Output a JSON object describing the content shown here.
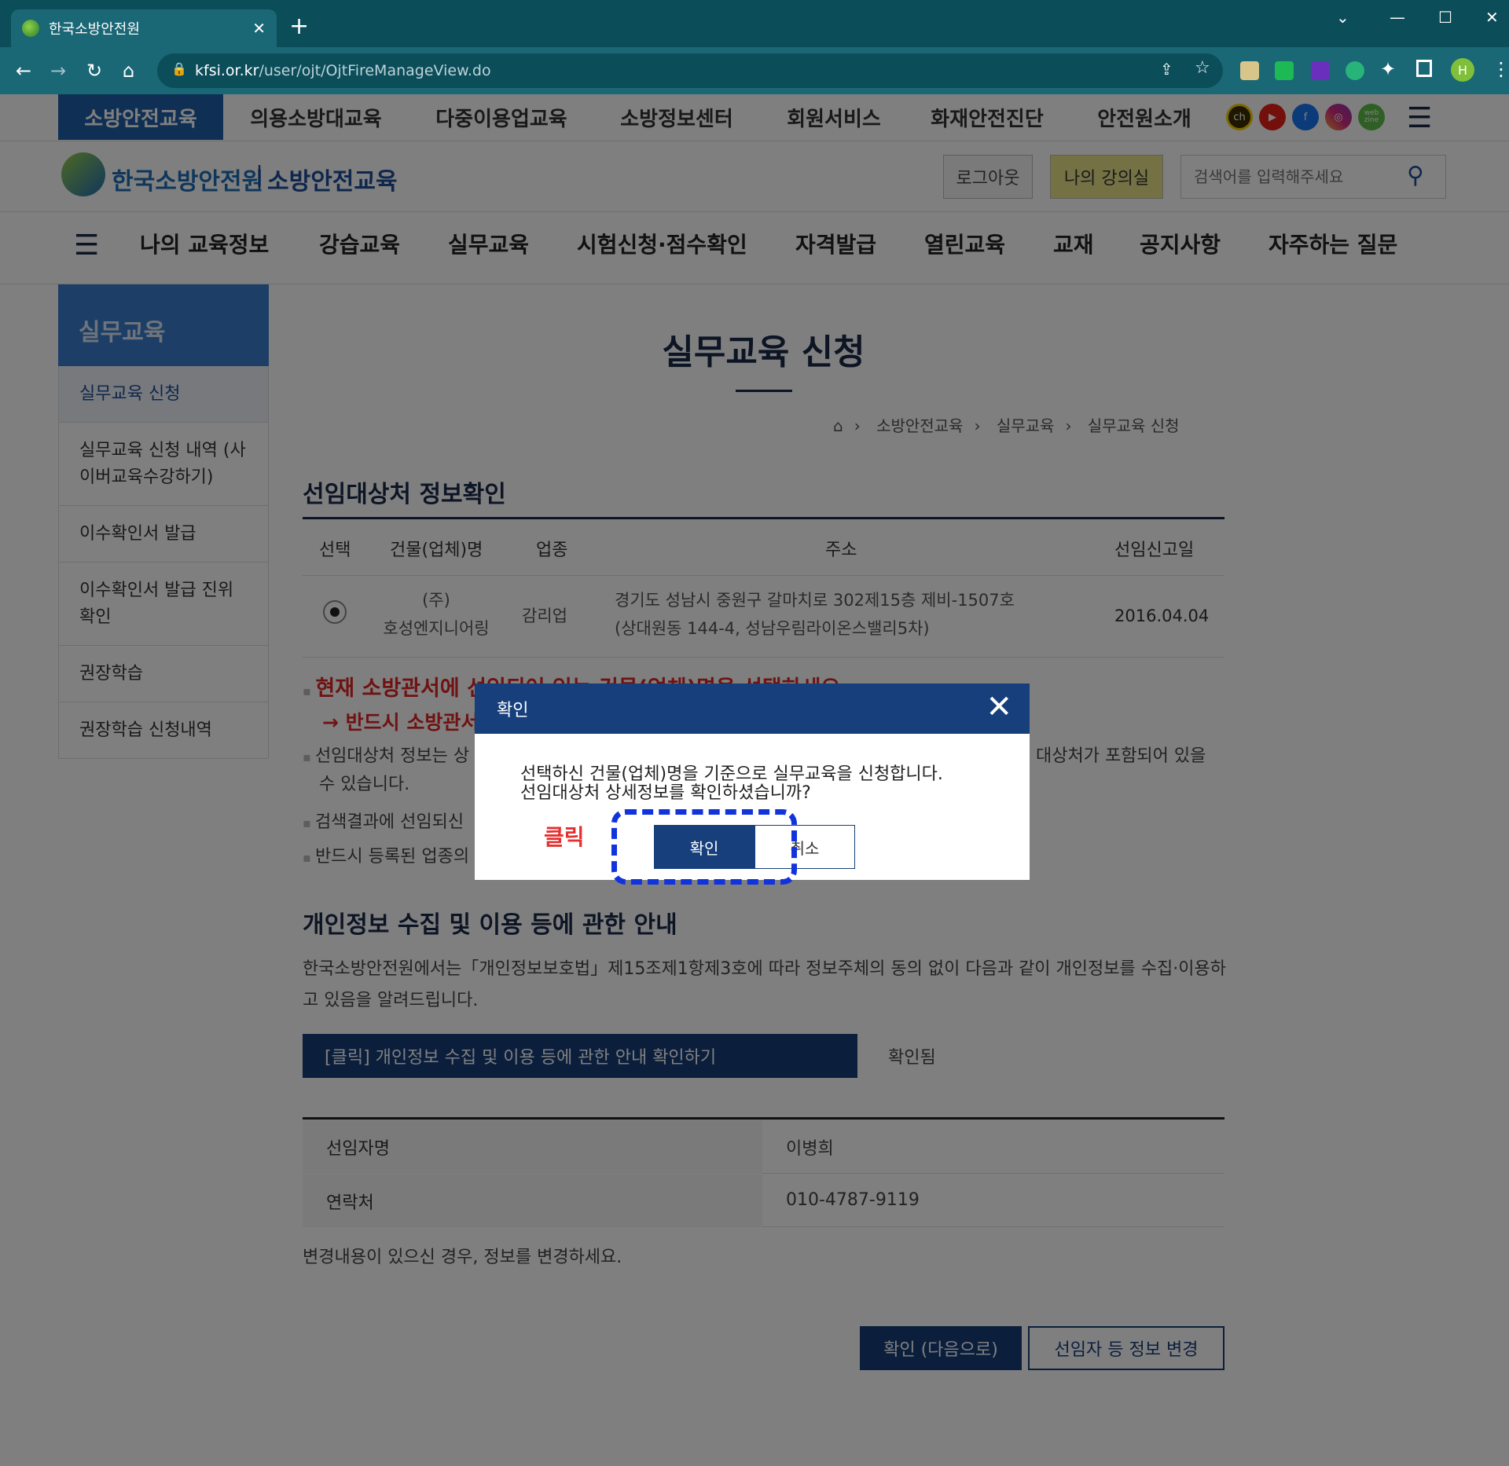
{
  "browser": {
    "tab_title": "한국소방안전원",
    "url_host": "kfsi.or.kr",
    "url_path": "/user/ojt/OjtFireManageView.do",
    "profile_initial": "H"
  },
  "gnb": {
    "items": [
      "소방안전교육",
      "의용소방대교육",
      "다중이용업교육",
      "소방정보센터",
      "회원서비스",
      "화재안전진단",
      "안전원소개"
    ],
    "sns_webzine": "web zine"
  },
  "header": {
    "logo_text": "한국소방안전원",
    "logo_sub": "소방안전교육",
    "logout_label": "로그아웃",
    "my_classroom_label": "나의 강의실",
    "search_placeholder": "검색어를 입력해주세요"
  },
  "lnb": {
    "items": [
      "나의 교육정보",
      "강습교육",
      "실무교육",
      "시험신청·점수확인",
      "자격발급",
      "열린교육",
      "교재",
      "공지사항",
      "자주하는 질문"
    ]
  },
  "sidebar": {
    "title": "실무교육",
    "items": [
      {
        "label": "실무교육 신청"
      },
      {
        "label": "실무교육 신청 내역 (사이버교육수강하기)"
      },
      {
        "label": "이수확인서 발급"
      },
      {
        "label": "이수확인서 발급 진위 확인"
      },
      {
        "label": "권장학습"
      },
      {
        "label": "권장학습 신청내역"
      }
    ]
  },
  "page": {
    "title": "실무교육 신청",
    "breadcrumb": [
      "소방안전교육",
      "실무교육",
      "실무교육 신청"
    ]
  },
  "target_section": {
    "title": "선임대상처 정보확인",
    "headers": [
      "선택",
      "건물(업체)명",
      "업종",
      "주소",
      "선임신고일"
    ],
    "row": {
      "name_line1": "(주)",
      "name_line2": "호성엔지니어링",
      "industry": "감리업",
      "address_line1": "경기도 성남시 중원구 갈마치로 302제15층 제비-1507호",
      "address_line2": "(상대원동 144-4, 성남우림라이온스밸리5차)",
      "date": "2016.04.04"
    },
    "notice_red_1": "현재 소방관서에 선임되어 있는 건물(업체)명을 선택하세요.",
    "notice_red_2": "→ 반드시 소방관서",
    "notice_3a": "선임대상처 정보는 상",
    "notice_3b": "대상처가 포함되어 있을",
    "notice_3c": "수 있습니다.",
    "notice_4": "검색결과에 선임되신",
    "notice_5": "반드시 등록된 업종의"
  },
  "privacy": {
    "title": "개인정보 수집 및 이용 등에 관한 안내",
    "text": "한국소방안전원에서는「개인정보보호법」제15조제1항제3호에 따라 정보주체의 동의 없이 다음과 같이 개인정보를 수집·이용하고 있음을 알려드립니다.",
    "button_label": "[클릭] 개인정보 수집 및 이용 등에 관한 안내 확인하기",
    "status": "확인됨"
  },
  "appointee": {
    "rows": [
      {
        "label": "선임자명",
        "value": "이병희"
      },
      {
        "label": "연락처",
        "value": "010-4787-9119"
      }
    ],
    "change_note": "변경내용이 있으신 경우, 정보를 변경하세요.",
    "next_label": "확인 (다음으로)",
    "change_label": "선임자 등 정보 변경"
  },
  "modal": {
    "title": "확인",
    "message_line1": "선택하신 건물(업체)명을 기준으로 실무교육을 신청합니다.",
    "message_line2": "선임대상처 상세정보를 확인하셨습니까?",
    "ok_label": "확인",
    "cancel_label": "취소",
    "hint_label": "클릭"
  },
  "colors": {
    "brand_navy": "#163f7c",
    "gnb_active": "#1f5ea8",
    "chrome": "#1a6775",
    "notice_red": "#e02424",
    "hint_blue": "#1133dd"
  }
}
